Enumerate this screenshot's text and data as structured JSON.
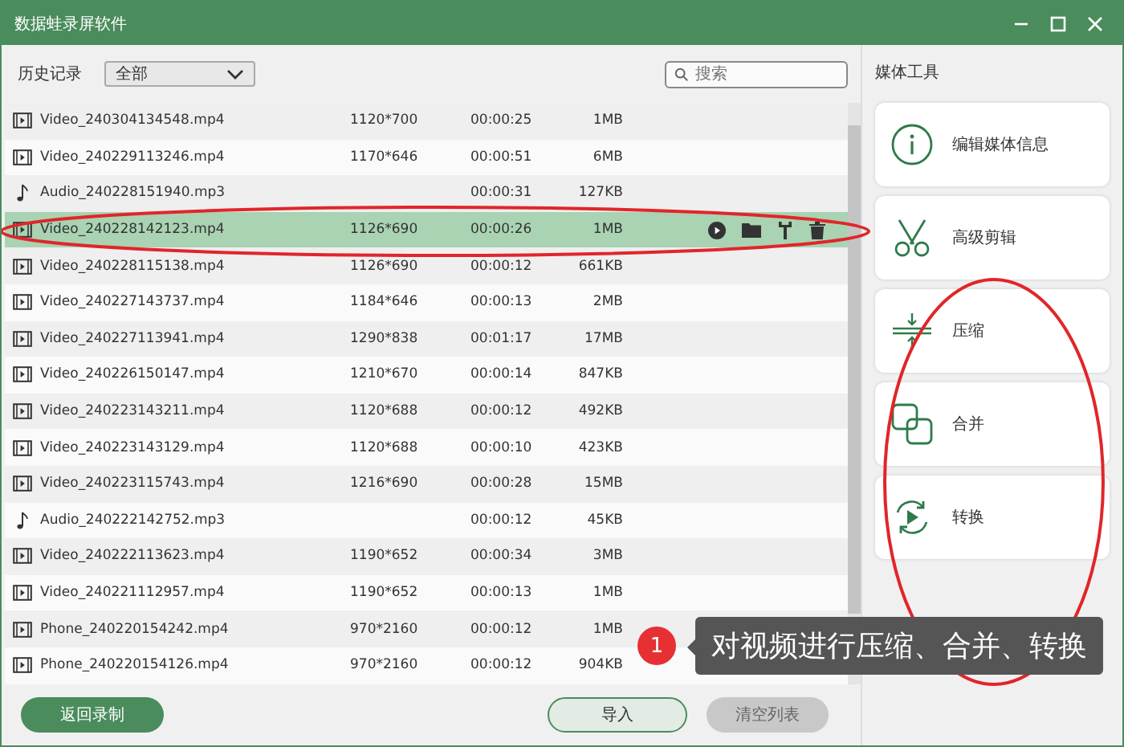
{
  "window": {
    "title": "数据蛙录屏软件"
  },
  "toolbar": {
    "label": "历史记录",
    "filter": "全部",
    "search": {
      "placeholder": "搜索"
    }
  },
  "files": [
    {
      "kind": "video",
      "name": "Video_240304134548.mp4",
      "resolution": "1120*700",
      "duration": "00:00:25",
      "size": "1MB",
      "selected": false
    },
    {
      "kind": "video",
      "name": "Video_240229113246.mp4",
      "resolution": "1170*646",
      "duration": "00:00:51",
      "size": "6MB",
      "selected": false
    },
    {
      "kind": "audio",
      "name": "Audio_240228151940.mp3",
      "duration": "00:00:31",
      "size": "127KB",
      "selected": false
    },
    {
      "kind": "video",
      "name": "Video_240228142123.mp4",
      "resolution": "1126*690",
      "duration": "00:00:26",
      "size": "1MB",
      "selected": true
    },
    {
      "kind": "video",
      "name": "Video_240228115138.mp4",
      "resolution": "1126*690",
      "duration": "00:00:12",
      "size": "661KB",
      "selected": false
    },
    {
      "kind": "video",
      "name": "Video_240227143737.mp4",
      "resolution": "1184*646",
      "duration": "00:00:13",
      "size": "2MB",
      "selected": false
    },
    {
      "kind": "video",
      "name": "Video_240227113941.mp4",
      "resolution": "1290*838",
      "duration": "00:01:17",
      "size": "17MB",
      "selected": false
    },
    {
      "kind": "video",
      "name": "Video_240226150147.mp4",
      "resolution": "1210*670",
      "duration": "00:00:14",
      "size": "847KB",
      "selected": false
    },
    {
      "kind": "video",
      "name": "Video_240223143211.mp4",
      "resolution": "1120*688",
      "duration": "00:00:12",
      "size": "492KB",
      "selected": false
    },
    {
      "kind": "video",
      "name": "Video_240223143129.mp4",
      "resolution": "1120*688",
      "duration": "00:00:10",
      "size": "423KB",
      "selected": false
    },
    {
      "kind": "video",
      "name": "Video_240223115743.mp4",
      "resolution": "1216*690",
      "duration": "00:00:28",
      "size": "15MB",
      "selected": false
    },
    {
      "kind": "audio",
      "name": "Audio_240222142752.mp3",
      "duration": "00:00:12",
      "size": "45KB",
      "selected": false
    },
    {
      "kind": "video",
      "name": "Video_240222113623.mp4",
      "resolution": "1190*652",
      "duration": "00:00:34",
      "size": "3MB",
      "selected": false
    },
    {
      "kind": "video",
      "name": "Video_240221112957.mp4",
      "resolution": "1190*652",
      "duration": "00:00:13",
      "size": "1MB",
      "selected": false
    },
    {
      "kind": "video",
      "name": "Phone_240220154242.mp4",
      "resolution": "970*2160",
      "duration": "00:00:12",
      "size": "1MB",
      "selected": false
    },
    {
      "kind": "video",
      "name": "Phone_240220154126.mp4",
      "resolution": "970*2160",
      "duration": "00:00:12",
      "size": "904KB",
      "selected": false
    }
  ],
  "sidebar": {
    "title": "媒体工具",
    "tools": [
      {
        "kind": "info",
        "label": "编辑媒体信息"
      },
      {
        "kind": "cut",
        "label": "高级剪辑"
      },
      {
        "kind": "compress",
        "label": "压缩"
      },
      {
        "kind": "merge",
        "label": "合并"
      },
      {
        "kind": "convert",
        "label": "转换"
      }
    ]
  },
  "buttons": {
    "back": "返回录制",
    "import": "导入",
    "clear": "清空列表"
  },
  "callout": {
    "badge": "1",
    "text": "对视频进行压缩、合并、转换"
  }
}
